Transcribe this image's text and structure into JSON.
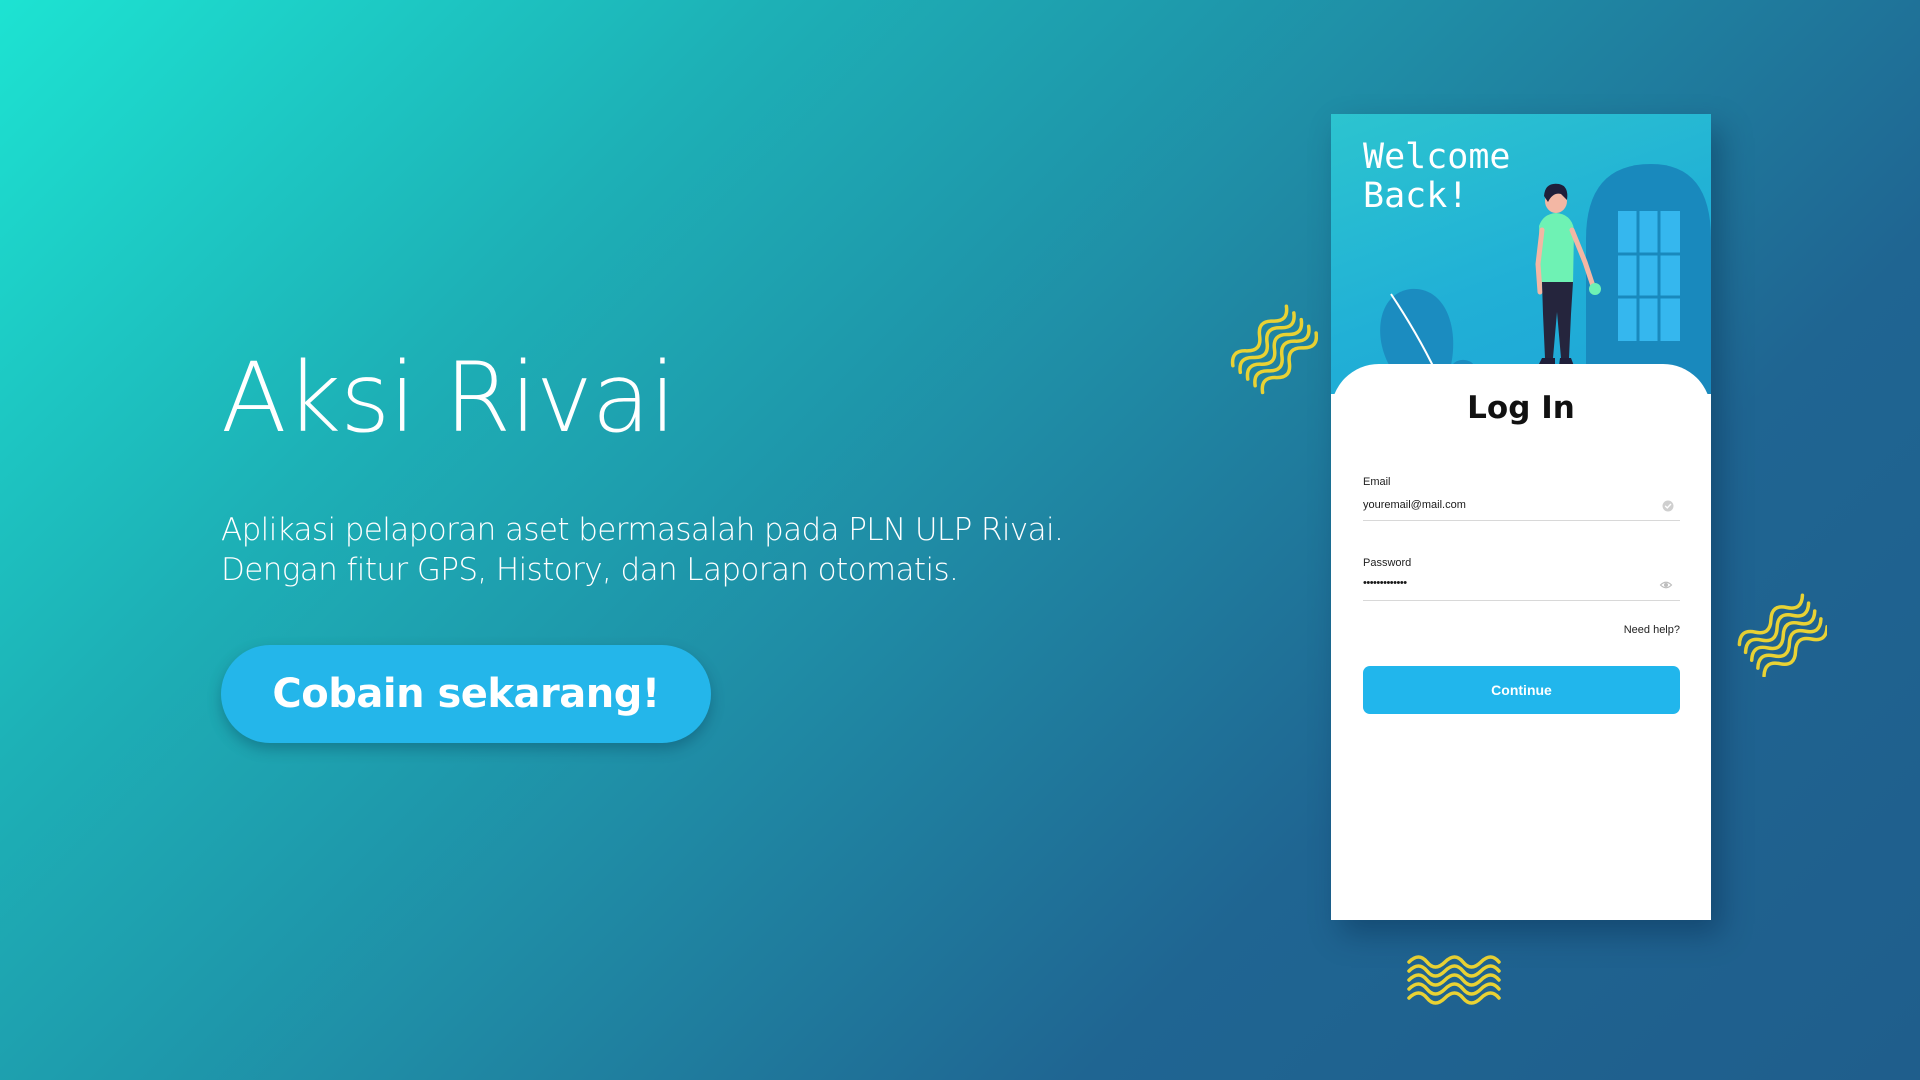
{
  "hero": {
    "title": "Aksi Rivai",
    "description_line1": "Aplikasi pelaporan aset bermasalah pada PLN ULP Rivai.",
    "description_line2": "Dengan fitur GPS, History, dan Laporan otomatis.",
    "cta_label": "Cobain sekarang!"
  },
  "phone": {
    "welcome": "Welcome\nBack!",
    "login_title": "Log In",
    "email_label": "Email",
    "email_value": "youremail@mail.com",
    "password_label": "Password",
    "password_value": "•••••••••••••",
    "help_link": "Need help?",
    "continue_label": "Continue"
  },
  "icons": {
    "email_status": "check-circle-icon",
    "password_toggle": "eye-icon",
    "decoration": "squiggle-icon"
  },
  "colors": {
    "accent": "#24b6ea",
    "squiggle": "#e9d234",
    "gradient_start": "#1de3d2",
    "gradient_end": "#1f5e8c"
  }
}
